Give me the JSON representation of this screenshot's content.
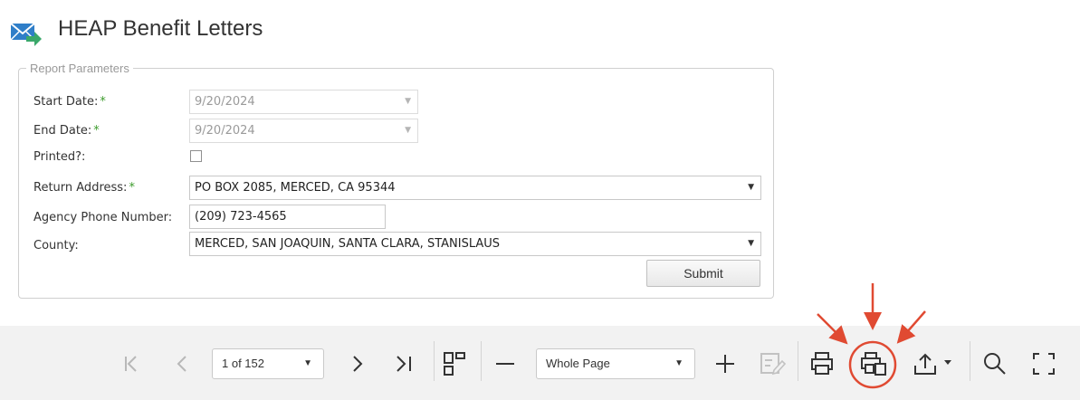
{
  "header": {
    "title": "HEAP Benefit Letters",
    "icon": "mail-forward-icon"
  },
  "form": {
    "legend": "Report Parameters",
    "start_date": {
      "label": "Start Date:",
      "required_mark": "*",
      "value": "9/20/2024"
    },
    "end_date": {
      "label": "End Date:",
      "required_mark": "*",
      "value": "9/20/2024"
    },
    "printed": {
      "label": "Printed?:",
      "checked": false
    },
    "return_address": {
      "label": "Return Address:",
      "required_mark": "*",
      "value": "PO BOX 2085, MERCED, CA  95344"
    },
    "agency_phone": {
      "label": "Agency Phone Number:",
      "value": "(209) 723-4565"
    },
    "county": {
      "label": "County:",
      "value": "MERCED, SAN JOAQUIN, SANTA CLARA, STANISLAUS"
    },
    "submit_label": "Submit"
  },
  "toolbar": {
    "page_selector": "1 of 152",
    "zoom_selector": "Whole Page",
    "buttons": [
      "first-page-icon",
      "previous-page-icon",
      "next-page-icon",
      "last-page-icon",
      "multipage-view-icon",
      "zoom-out-icon",
      "zoom-in-icon",
      "editing-fields-icon",
      "print-icon",
      "print-page-icon",
      "export-icon",
      "search-icon",
      "full-screen-icon"
    ]
  },
  "colors": {
    "required": "#3c9b2c",
    "annotation": "#e04a32",
    "toolbar_bg": "#f2f2f2"
  }
}
